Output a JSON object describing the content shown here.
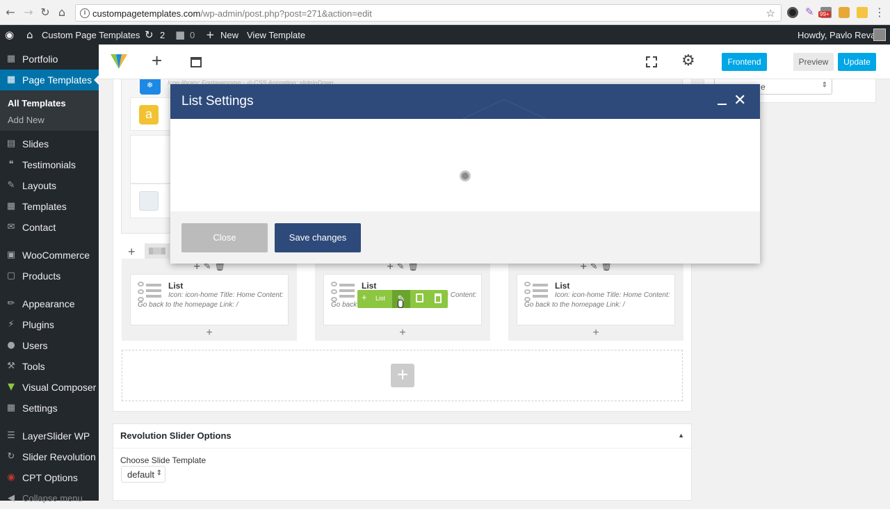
{
  "browser": {
    "url_host": "custompagetemplates.com",
    "url_path": "/wp-admin/post.php?post=271&action=edit",
    "badge": "99+"
  },
  "adminbar": {
    "site_name": "Custom Page Templates",
    "updates_count": "2",
    "comments_count": "0",
    "new_label": "New",
    "view_label": "View Template",
    "greeting": "Howdy, Pavlo Reva"
  },
  "sidebar": {
    "items": [
      {
        "label": "Portfolio",
        "icon": "folder-icon"
      },
      {
        "label": "Page Templates",
        "icon": "grid-icon"
      },
      {
        "label": "Slides",
        "icon": "slides-icon"
      },
      {
        "label": "Testimonials",
        "icon": "quote-icon"
      },
      {
        "label": "Layouts",
        "icon": "pencil-icon"
      },
      {
        "label": "Templates",
        "icon": "grid-icon"
      },
      {
        "label": "Contact",
        "icon": "envelope-icon"
      },
      {
        "label": "WooCommerce",
        "icon": "woo-icon"
      },
      {
        "label": "Products",
        "icon": "box-icon"
      },
      {
        "label": "Appearance",
        "icon": "brush-icon"
      },
      {
        "label": "Plugins",
        "icon": "plug-icon"
      },
      {
        "label": "Users",
        "icon": "user-icon"
      },
      {
        "label": "Tools",
        "icon": "wrench-icon"
      },
      {
        "label": "Visual Composer",
        "icon": "vc-icon"
      },
      {
        "label": "Settings",
        "icon": "settings-icon"
      },
      {
        "label": "LayerSlider WP",
        "icon": "layers-icon"
      },
      {
        "label": "Slider Revolution",
        "icon": "refresh-icon"
      },
      {
        "label": "CPT Options",
        "icon": "cpt-icon"
      },
      {
        "label": "Collapse menu",
        "icon": "collapse-icon"
      }
    ],
    "submenu": [
      "All Templates",
      "Add New"
    ]
  },
  "vc_toolbar": {
    "frontend_label": "Frontend",
    "preview_label": "Preview",
    "update_label": "Update"
  },
  "editor": {
    "faded_text": "Icon library: Fontawesome · ◎ CSS Animation: slideInDown",
    "columns": [
      {
        "title": "List",
        "description": "Icon: icon-home  Title: Home  Content: Go back to the homepage  Link: /"
      },
      {
        "title": "List",
        "description": "Icon: icon-home  Title: Home  Content: Go back to the homepage  Link: /"
      },
      {
        "title": "List",
        "description": "Icon: icon-home  Title: Home  Content: Go back to the homepage  Link: /"
      }
    ],
    "hover_add_label": "List"
  },
  "modal": {
    "title": "List Settings",
    "close_label": "Close",
    "save_label": "Save changes"
  },
  "revolution": {
    "title": "Revolution Slider Options",
    "template_label": "Choose Slide Template",
    "template_value": "default"
  },
  "right_panel": {
    "select_value": "e"
  },
  "colors": {
    "admin_dark": "#23282d",
    "wp_blue": "#0073aa",
    "modal_header": "#2e4a7a",
    "vc_green": "#8dc641",
    "frontend_blue": "#00a6e6"
  }
}
